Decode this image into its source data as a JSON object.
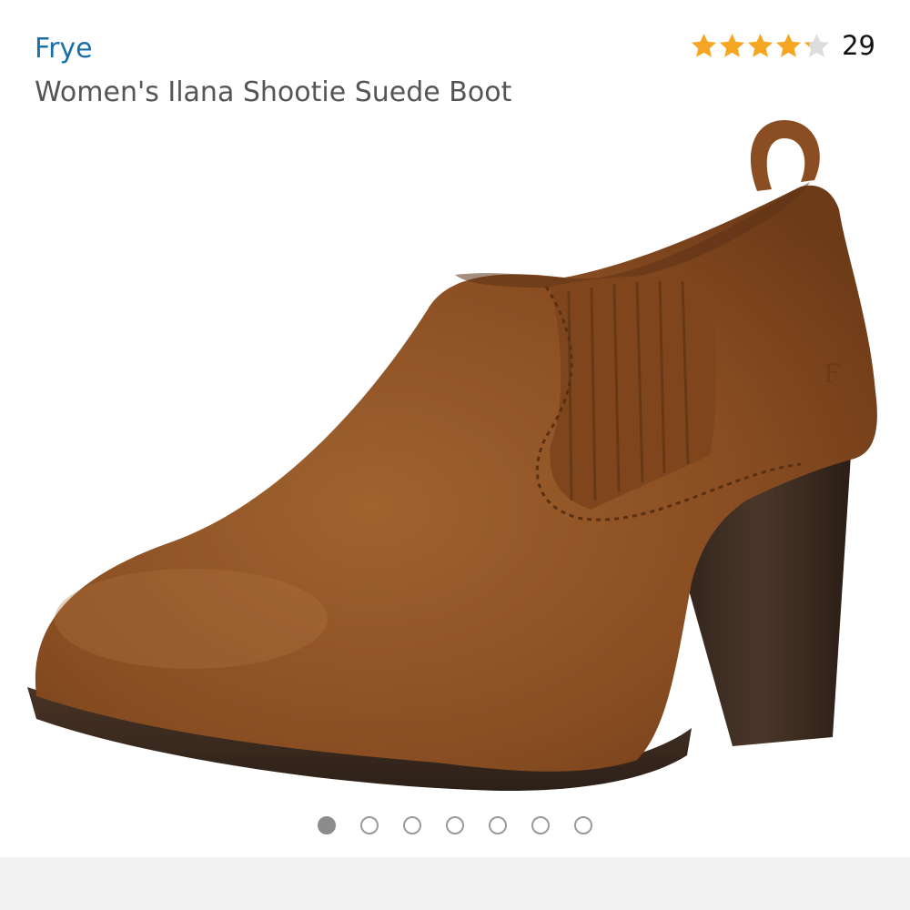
{
  "product": {
    "brand": "Frye",
    "title": "Women's Ilana Shootie Suede Boot",
    "rating": 4.2,
    "rating_max": 5,
    "review_count": "29"
  },
  "gallery": {
    "image_count": 7,
    "active_index": 0,
    "image_alt": "Women's Ilana Shootie Suede Boot"
  },
  "colors": {
    "brand_link": "#1a6fa8",
    "star_filled": "#f5a623",
    "star_empty": "#dddddd",
    "suede": "#8a4e22",
    "heel": "#3b2a20"
  }
}
